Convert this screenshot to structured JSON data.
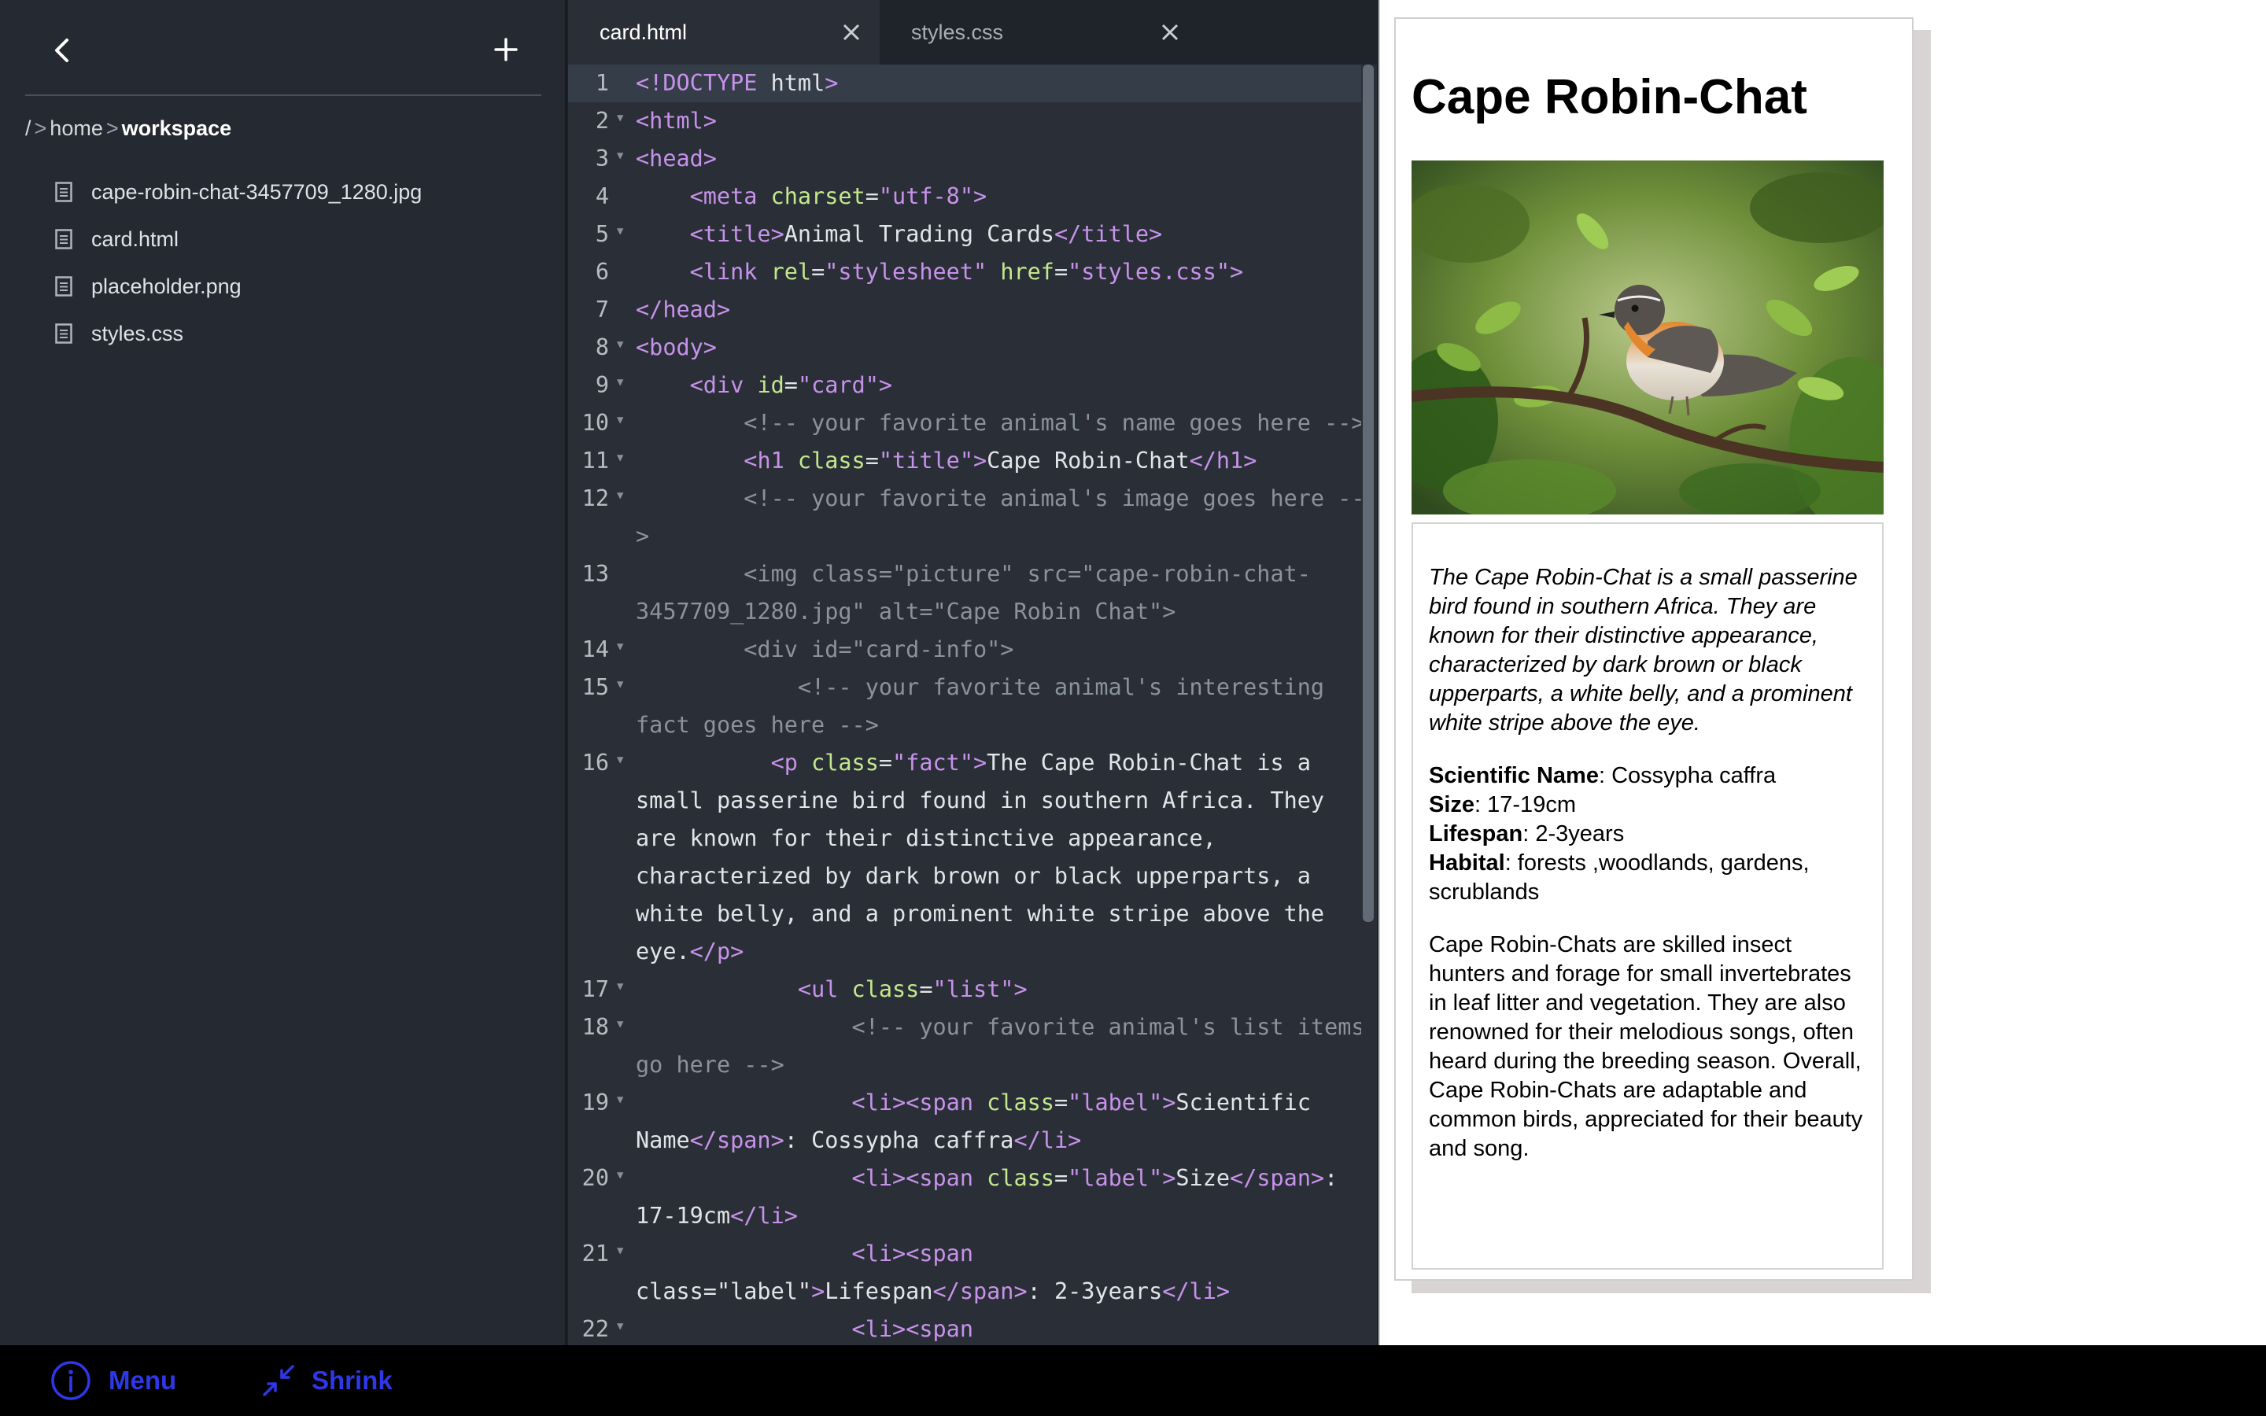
{
  "sidebar": {
    "back_icon": "chevron-left-icon",
    "add_icon": "plus-icon",
    "breadcrumb": {
      "root": "/",
      "separator": ">",
      "parent": "home",
      "current": "workspace"
    },
    "files": [
      {
        "name": "cape-robin-chat-3457709_1280.jpg",
        "icon": "file-icon"
      },
      {
        "name": "card.html",
        "icon": "file-icon"
      },
      {
        "name": "placeholder.png",
        "icon": "file-icon"
      },
      {
        "name": "styles.css",
        "icon": "file-icon"
      }
    ]
  },
  "editor": {
    "tabs": [
      {
        "label": "card.html",
        "active": true
      },
      {
        "label": "styles.css",
        "active": false
      }
    ],
    "line_numbers": [
      "1",
      "2",
      "3",
      "4",
      "5",
      "6",
      "7",
      "8",
      "9",
      "10",
      "11",
      "12",
      "",
      "13",
      "",
      "14",
      "15",
      "",
      "16",
      "",
      "",
      "",
      "",
      "",
      "17",
      "18",
      "",
      "19",
      "",
      "20",
      "",
      "21",
      "",
      "22"
    ],
    "code": [
      "<!DOCTYPE html>",
      "<html>",
      "<head>",
      "    <meta charset=\"utf-8\">",
      "    <title>Animal Trading Cards</title>",
      "    <link rel=\"stylesheet\" href=\"styles.css\">",
      "</head>",
      "<body>",
      "    <div id=\"card\">",
      "        <!-- your favorite animal's name goes here -->",
      "        <h1 class=\"title\">Cape Robin-Chat</h1>",
      "        <!-- your favorite animal's image goes here --",
      ">",
      "        <img class=\"picture\" src=\"cape-robin-chat-",
      "3457709_1280.jpg\" alt=\"Cape Robin Chat\">",
      "        <div id=\"card-info\">",
      "            <!-- your favorite animal's interesting",
      "fact goes here -->",
      "          <p class=\"fact\">The Cape Robin-Chat is a",
      "small passerine bird found in southern Africa. They",
      "are known for their distinctive appearance,",
      "characterized by dark brown or black upperparts, a",
      "white belly, and a prominent white stripe above the",
      "eye.</p>",
      "            <ul class=\"list\">",
      "                <!-- your favorite animal's list items",
      "go here -->",
      "                <li><span class=\"label\">Scientific",
      "Name</span>: Cossypha caffra</li>",
      "                <li><span class=\"label\">Size</span>:",
      "17-19cm</li>",
      "                <li><span",
      "class=\"label\">Lifespan</span>: 2-3years</li>",
      "                <li><span"
    ]
  },
  "preview": {
    "title": "Cape Robin-Chat",
    "picture_alt": "Cape Robin Chat",
    "fact": "The Cape Robin-Chat is a small passerine bird found in southern Africa. They are known for their distinctive appearance, characterized by dark brown or black upperparts, a white belly, and a prominent white stripe above the eye.",
    "list": [
      {
        "label": "Scientific Name",
        "value": ": Cossypha caffra"
      },
      {
        "label": "Size",
        "value": ": 17-19cm"
      },
      {
        "label": "Lifespan",
        "value": ": 2-3years"
      },
      {
        "label": "Habital",
        "value": ": forests ,woodlands, gardens, scrublands"
      }
    ],
    "description": "Cape Robin-Chats are skilled insect hunters and forage for small invertebrates in leaf litter and vegetation. They are also renowned for their melodious songs, often heard during the breeding season. Overall, Cape Robin-Chats are adaptable and common birds, appreciated for their beauty and song."
  },
  "bottom_bar": {
    "menu": {
      "label": "Menu",
      "icon": "info-icon"
    },
    "shrink": {
      "label": "Shrink",
      "icon": "shrink-arrows-icon"
    },
    "accent": "#2f37e6"
  }
}
